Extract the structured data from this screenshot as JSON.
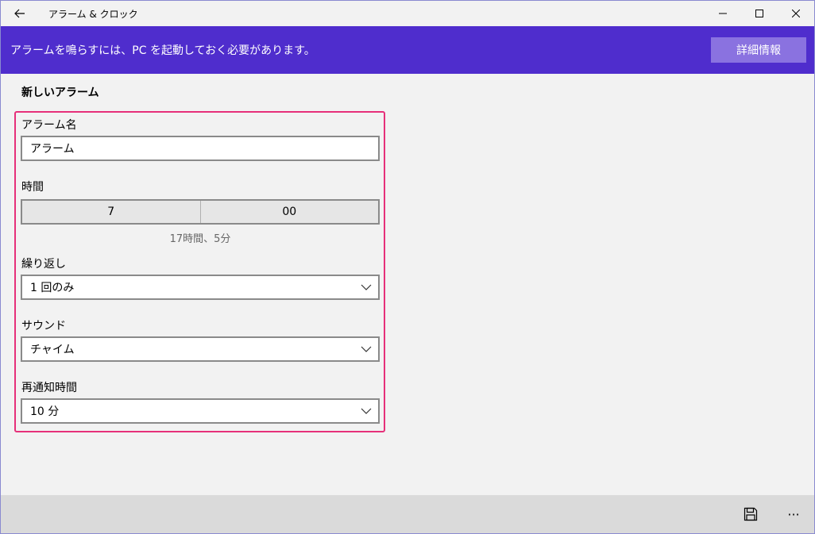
{
  "window": {
    "title": "アラーム & クロック",
    "back_icon": "back-arrow-icon",
    "controls": [
      "minimize-icon",
      "maximize-icon",
      "close-icon"
    ]
  },
  "banner": {
    "message": "アラームを鳴らすには、PC を起動しておく必要があります。",
    "button_label": "詳細情報",
    "color": "#4f2dcd"
  },
  "page": {
    "heading": "新しいアラーム"
  },
  "form": {
    "name_label": "アラーム名",
    "name_value": "アラーム",
    "time_label": "時間",
    "hour": "7",
    "minute": "00",
    "time_until": "17時間、5分",
    "repeat_label": "繰り返し",
    "repeat_value": "1 回のみ",
    "sound_label": "サウンド",
    "sound_value": "チャイム",
    "snooze_label": "再通知時間",
    "snooze_value": "10 分",
    "highlight_color": "#e6307a"
  },
  "commandbar": {
    "save_icon": "save-icon",
    "more_label": "···"
  }
}
